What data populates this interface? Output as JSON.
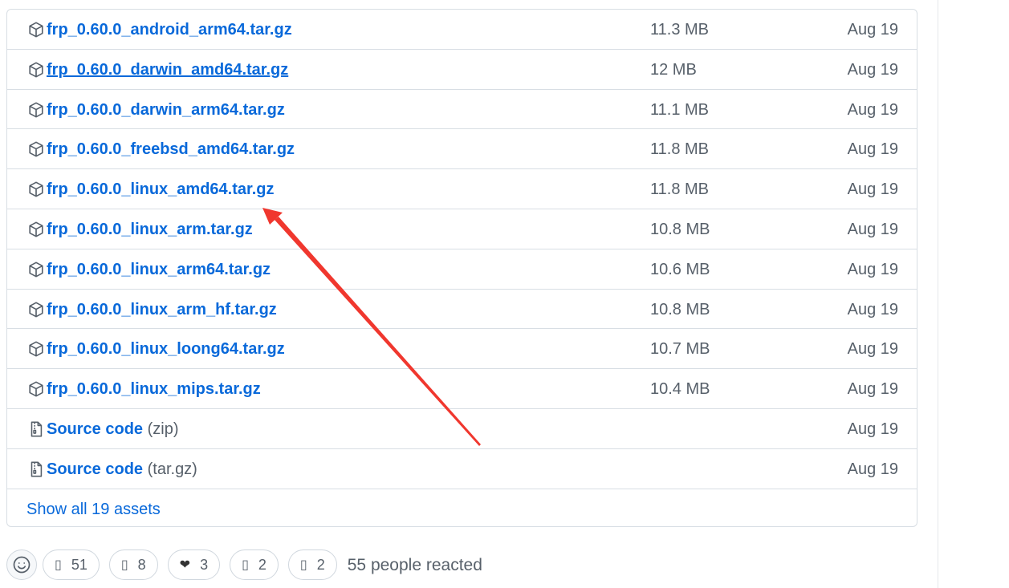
{
  "assets": [
    {
      "name": "frp_0.60.0_android_arm64.tar.gz",
      "size": "11.3 MB",
      "date": "Aug 19",
      "icon": "package-icon"
    },
    {
      "name": "frp_0.60.0_darwin_amd64.tar.gz",
      "size": "12 MB",
      "date": "Aug 19",
      "icon": "package-icon"
    },
    {
      "name": "frp_0.60.0_darwin_arm64.tar.gz",
      "size": "11.1 MB",
      "date": "Aug 19",
      "icon": "package-icon"
    },
    {
      "name": "frp_0.60.0_freebsd_amd64.tar.gz",
      "size": "11.8 MB",
      "date": "Aug 19",
      "icon": "package-icon"
    },
    {
      "name": "frp_0.60.0_linux_amd64.tar.gz",
      "size": "11.8 MB",
      "date": "Aug 19",
      "icon": "package-icon"
    },
    {
      "name": "frp_0.60.0_linux_arm.tar.gz",
      "size": "10.8 MB",
      "date": "Aug 19",
      "icon": "package-icon"
    },
    {
      "name": "frp_0.60.0_linux_arm64.tar.gz",
      "size": "10.6 MB",
      "date": "Aug 19",
      "icon": "package-icon"
    },
    {
      "name": "frp_0.60.0_linux_arm_hf.tar.gz",
      "size": "10.8 MB",
      "date": "Aug 19",
      "icon": "package-icon"
    },
    {
      "name": "frp_0.60.0_linux_loong64.tar.gz",
      "size": "10.7 MB",
      "date": "Aug 19",
      "icon": "package-icon"
    },
    {
      "name": "frp_0.60.0_linux_mips.tar.gz",
      "size": "10.4 MB",
      "date": "Aug 19",
      "icon": "package-icon"
    }
  ],
  "source_code": [
    {
      "label": "Source code",
      "format": "(zip)",
      "date": "Aug 19",
      "icon": "file-zip-icon"
    },
    {
      "label": "Source code",
      "format": "(tar.gz)",
      "date": "Aug 19",
      "icon": "file-zip-icon"
    }
  ],
  "show_all_label": "Show all 19 assets",
  "reactions": {
    "items": [
      {
        "count": "51",
        "icon": "thumbs-up-icon"
      },
      {
        "count": "8",
        "icon": "hooray-icon"
      },
      {
        "count": "3",
        "icon": "heart-icon"
      },
      {
        "count": "2",
        "icon": "rocket-icon"
      },
      {
        "count": "2",
        "icon": "eyes-icon"
      }
    ],
    "summary": "55 people reacted"
  },
  "colors": {
    "link": "#0969da",
    "muted": "#57606a",
    "border": "#d8dee4",
    "annotation_arrow": "#f0372e"
  }
}
